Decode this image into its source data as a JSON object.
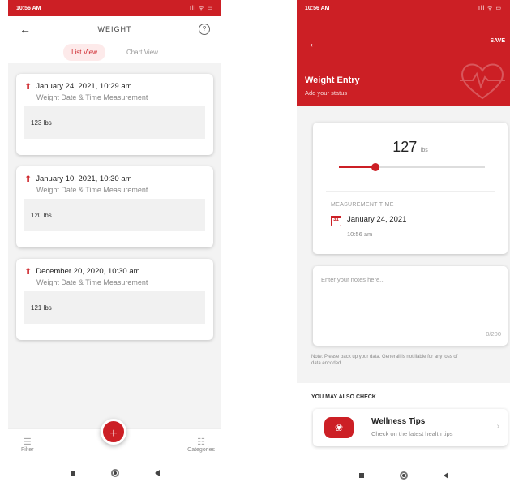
{
  "colors": {
    "accent": "#cc1f25"
  },
  "left": {
    "status": {
      "time": "10:56 AM",
      "indicators": "ıll ᯤ ▭"
    },
    "header": {
      "back_icon": "←",
      "title": "WEIGHT",
      "help_icon": "?"
    },
    "tabs": [
      {
        "label": "List View",
        "active": true
      },
      {
        "label": "Chart View",
        "active": false
      }
    ],
    "entries": [
      {
        "date": "January 24, 2021, 10:29 am",
        "subtitle": "Weight Date & Time Measurement",
        "value": "123 lbs"
      },
      {
        "date": "January 10, 2021, 10:30 am",
        "subtitle": "Weight Date & Time Measurement",
        "value": "120 lbs"
      },
      {
        "date": "December 20, 2020, 10:30 am",
        "subtitle": "Weight Date & Time Measurement",
        "value": "121 lbs"
      }
    ],
    "bottom_nav": {
      "fab": "+",
      "filter_label": "Filter",
      "categories_label": "Categories"
    }
  },
  "right": {
    "status": {
      "time": "10:56 AM",
      "indicators": "ıll ᯤ ▭"
    },
    "header": {
      "back_icon": "←",
      "save_label": "SAVE",
      "title": "Weight Entry",
      "subtitle": "Add your status"
    },
    "weight": {
      "value": "127",
      "unit": "lbs",
      "slider_fraction": 0.25
    },
    "measurement": {
      "label": "MEASUREMENT TIME",
      "calendar_day": "31",
      "date": "January 24, 2021",
      "time": "10:56 am"
    },
    "notes": {
      "placeholder": "Enter your notes here...",
      "counter": "0/200"
    },
    "disclaimer": "Note: Please back up your data. Generali is not liable for any loss of data encoded.",
    "also_check": {
      "label": "YOU MAY ALSO CHECK",
      "card": {
        "title": "Wellness Tips",
        "subtitle": "Check on the latest health tips",
        "icon": "lotus-icon",
        "icon_glyph": "❀",
        "chevron": "›"
      }
    }
  }
}
